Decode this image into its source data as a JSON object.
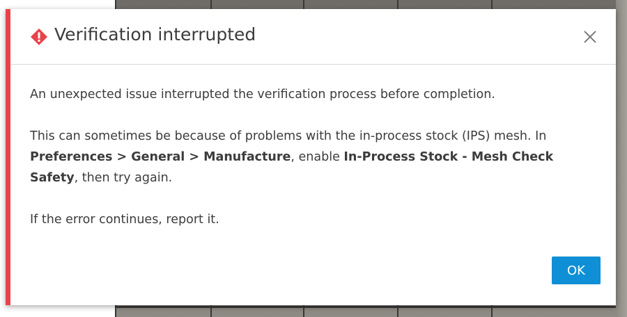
{
  "dialog": {
    "title": "Verification interrupted",
    "icon": "warning-diamond-icon",
    "accent_color": "#e8434a",
    "paragraph1": "An unexpected issue interrupted the verification process before completion.",
    "paragraph2": {
      "part1": "This can sometimes be because of problems with the in-process stock (IPS) mesh. In ",
      "bold1": "Preferences > General > Manufacture",
      "part2": ", enable ",
      "bold2": "In-Process Stock - Mesh Check Safety",
      "part3": ", then try again."
    },
    "paragraph3": "If the error continues, report it.",
    "ok_label": "OK",
    "ok_color": "#0f8fd6"
  }
}
